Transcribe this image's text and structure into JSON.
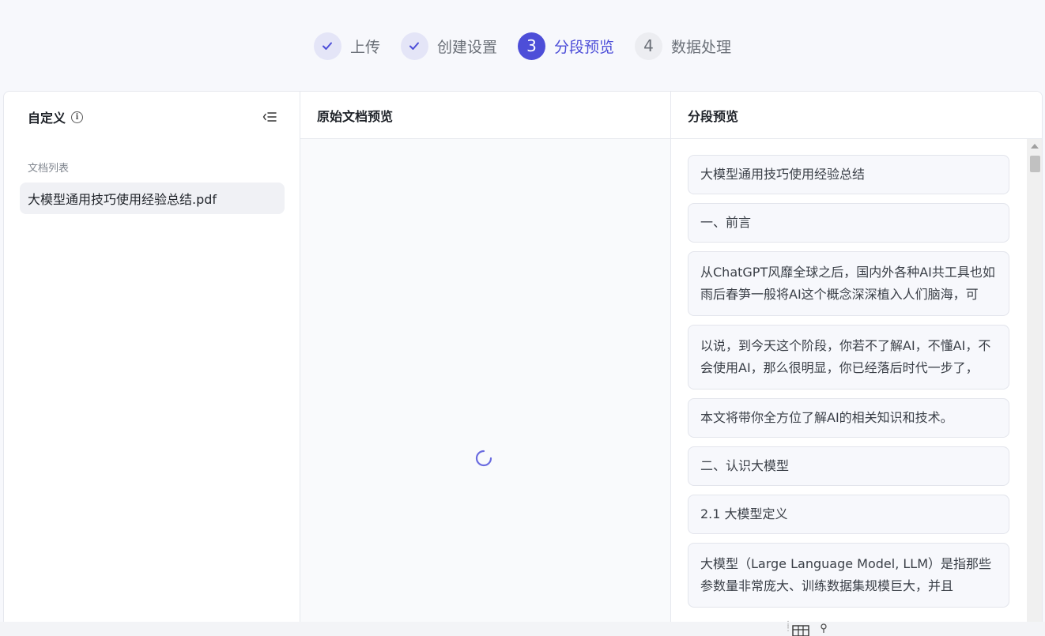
{
  "stepper": {
    "steps": [
      {
        "number": "",
        "label": "上传",
        "state": "done"
      },
      {
        "number": "",
        "label": "创建设置",
        "state": "done"
      },
      {
        "number": "3",
        "label": "分段预览",
        "state": "active"
      },
      {
        "number": "4",
        "label": "数据处理",
        "state": "todo"
      }
    ]
  },
  "left": {
    "title": "自定义",
    "doc_list_label": "文档列表",
    "documents": [
      "大模型通用技巧使用经验总结.pdf"
    ]
  },
  "middle": {
    "title": "原始文档预览"
  },
  "right": {
    "title": "分段预览",
    "segments": [
      "大模型通用技巧使用经验总结",
      "一、前言",
      "从ChatGPT风靡全球之后，国内外各种AI共工具也如雨后春笋一般将AI这个概念深深植入人们脑海，可",
      "以说，到今天这个阶段，你若不了解AI，不懂AI，不会使用AI，那么很明显，你已经落后时代一步了，",
      "本文将带你全方位了解AI的相关知识和技术。",
      "二、认识大模型",
      "2.1 大模型定义",
      "大模型（Large Language Model, LLM）是指那些参数量非常庞大、训练数据集规模巨大，并且"
    ]
  },
  "colors": {
    "accent": "#4d4ed8",
    "accent_light": "#e4e5f7"
  },
  "icons": {
    "done": "check-icon",
    "info": "info-icon",
    "collapse": "collapse-list-icon",
    "loading": "loading-spinner-icon"
  }
}
